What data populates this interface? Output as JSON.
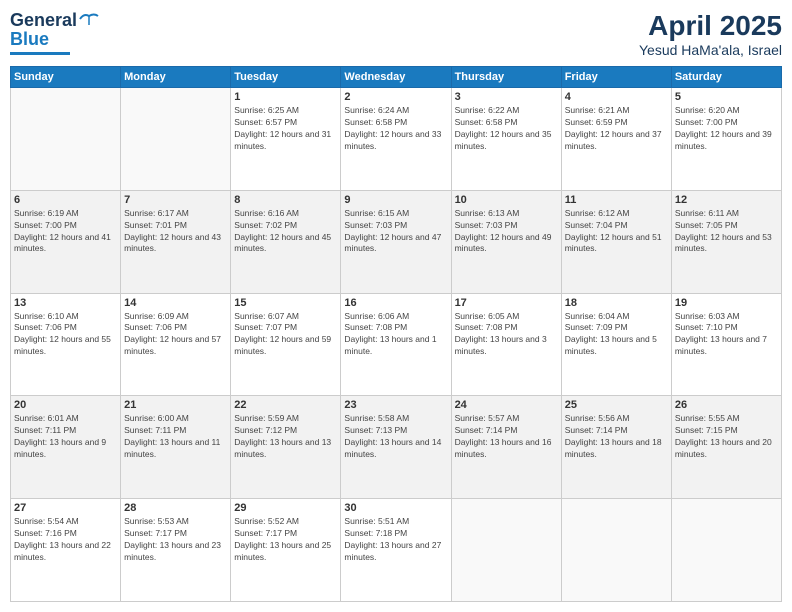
{
  "header": {
    "logo_general": "General",
    "logo_blue": "Blue",
    "month": "April 2025",
    "location": "Yesud HaMa'ala, Israel"
  },
  "weekdays": [
    "Sunday",
    "Monday",
    "Tuesday",
    "Wednesday",
    "Thursday",
    "Friday",
    "Saturday"
  ],
  "weeks": [
    [
      {
        "day": "",
        "empty": true
      },
      {
        "day": "",
        "empty": true
      },
      {
        "day": "1",
        "sunrise": "6:25 AM",
        "sunset": "6:57 PM",
        "daylight": "12 hours and 31 minutes."
      },
      {
        "day": "2",
        "sunrise": "6:24 AM",
        "sunset": "6:58 PM",
        "daylight": "12 hours and 33 minutes."
      },
      {
        "day": "3",
        "sunrise": "6:22 AM",
        "sunset": "6:58 PM",
        "daylight": "12 hours and 35 minutes."
      },
      {
        "day": "4",
        "sunrise": "6:21 AM",
        "sunset": "6:59 PM",
        "daylight": "12 hours and 37 minutes."
      },
      {
        "day": "5",
        "sunrise": "6:20 AM",
        "sunset": "7:00 PM",
        "daylight": "12 hours and 39 minutes."
      }
    ],
    [
      {
        "day": "6",
        "sunrise": "6:19 AM",
        "sunset": "7:00 PM",
        "daylight": "12 hours and 41 minutes."
      },
      {
        "day": "7",
        "sunrise": "6:17 AM",
        "sunset": "7:01 PM",
        "daylight": "12 hours and 43 minutes."
      },
      {
        "day": "8",
        "sunrise": "6:16 AM",
        "sunset": "7:02 PM",
        "daylight": "12 hours and 45 minutes."
      },
      {
        "day": "9",
        "sunrise": "6:15 AM",
        "sunset": "7:03 PM",
        "daylight": "12 hours and 47 minutes."
      },
      {
        "day": "10",
        "sunrise": "6:13 AM",
        "sunset": "7:03 PM",
        "daylight": "12 hours and 49 minutes."
      },
      {
        "day": "11",
        "sunrise": "6:12 AM",
        "sunset": "7:04 PM",
        "daylight": "12 hours and 51 minutes."
      },
      {
        "day": "12",
        "sunrise": "6:11 AM",
        "sunset": "7:05 PM",
        "daylight": "12 hours and 53 minutes."
      }
    ],
    [
      {
        "day": "13",
        "sunrise": "6:10 AM",
        "sunset": "7:06 PM",
        "daylight": "12 hours and 55 minutes."
      },
      {
        "day": "14",
        "sunrise": "6:09 AM",
        "sunset": "7:06 PM",
        "daylight": "12 hours and 57 minutes."
      },
      {
        "day": "15",
        "sunrise": "6:07 AM",
        "sunset": "7:07 PM",
        "daylight": "12 hours and 59 minutes."
      },
      {
        "day": "16",
        "sunrise": "6:06 AM",
        "sunset": "7:08 PM",
        "daylight": "13 hours and 1 minute."
      },
      {
        "day": "17",
        "sunrise": "6:05 AM",
        "sunset": "7:08 PM",
        "daylight": "13 hours and 3 minutes."
      },
      {
        "day": "18",
        "sunrise": "6:04 AM",
        "sunset": "7:09 PM",
        "daylight": "13 hours and 5 minutes."
      },
      {
        "day": "19",
        "sunrise": "6:03 AM",
        "sunset": "7:10 PM",
        "daylight": "13 hours and 7 minutes."
      }
    ],
    [
      {
        "day": "20",
        "sunrise": "6:01 AM",
        "sunset": "7:11 PM",
        "daylight": "13 hours and 9 minutes."
      },
      {
        "day": "21",
        "sunrise": "6:00 AM",
        "sunset": "7:11 PM",
        "daylight": "13 hours and 11 minutes."
      },
      {
        "day": "22",
        "sunrise": "5:59 AM",
        "sunset": "7:12 PM",
        "daylight": "13 hours and 13 minutes."
      },
      {
        "day": "23",
        "sunrise": "5:58 AM",
        "sunset": "7:13 PM",
        "daylight": "13 hours and 14 minutes."
      },
      {
        "day": "24",
        "sunrise": "5:57 AM",
        "sunset": "7:14 PM",
        "daylight": "13 hours and 16 minutes."
      },
      {
        "day": "25",
        "sunrise": "5:56 AM",
        "sunset": "7:14 PM",
        "daylight": "13 hours and 18 minutes."
      },
      {
        "day": "26",
        "sunrise": "5:55 AM",
        "sunset": "7:15 PM",
        "daylight": "13 hours and 20 minutes."
      }
    ],
    [
      {
        "day": "27",
        "sunrise": "5:54 AM",
        "sunset": "7:16 PM",
        "daylight": "13 hours and 22 minutes."
      },
      {
        "day": "28",
        "sunrise": "5:53 AM",
        "sunset": "7:17 PM",
        "daylight": "13 hours and 23 minutes."
      },
      {
        "day": "29",
        "sunrise": "5:52 AM",
        "sunset": "7:17 PM",
        "daylight": "13 hours and 25 minutes."
      },
      {
        "day": "30",
        "sunrise": "5:51 AM",
        "sunset": "7:18 PM",
        "daylight": "13 hours and 27 minutes."
      },
      {
        "day": "",
        "empty": true
      },
      {
        "day": "",
        "empty": true
      },
      {
        "day": "",
        "empty": true
      }
    ]
  ]
}
